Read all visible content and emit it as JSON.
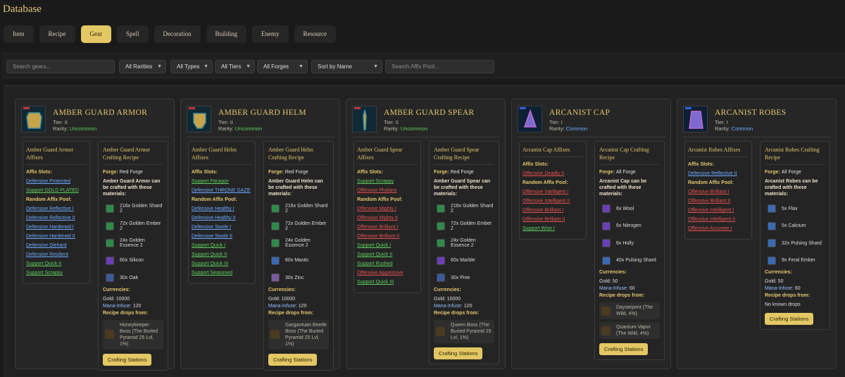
{
  "page": {
    "title": "Database"
  },
  "tabs": [
    {
      "label": "Item",
      "active": false
    },
    {
      "label": "Recipe",
      "active": false
    },
    {
      "label": "Gear",
      "active": true
    },
    {
      "label": "Spell",
      "active": false
    },
    {
      "label": "Decoration",
      "active": false
    },
    {
      "label": "Building",
      "active": false
    },
    {
      "label": "Enemy",
      "active": false
    },
    {
      "label": "Resource",
      "active": false
    }
  ],
  "filters": {
    "search_placeholder": "Search gears...",
    "rarity": "All Rarities",
    "type": "All Types",
    "tier": "All Tiers",
    "forge": "All Forges",
    "sort": "Sort by Name",
    "affix_placeholder": "Search Affix Pool..."
  },
  "labels": {
    "affix_slots": "Affix Slots:",
    "random_pool": "Random Affix Pool:",
    "forge": "Forge:",
    "currencies": "Currencies:",
    "gold": "Gold:",
    "mana": "Mana-Infuse:",
    "recipe_drops": "Recipe drops from:",
    "crafting_stations": "Crafting Stations"
  },
  "gears": [
    {
      "name": "AMBER GUARD ARMOR",
      "tier": "Tier: II",
      "rarity_label": "Rarity:",
      "rarity": "Uncommon",
      "affix_title": "Amber Guard Armor Affixes",
      "slots": [
        {
          "text": "Defensive Protected",
          "kind": "def"
        },
        {
          "text": "Support GOLD PLATED",
          "kind": "sup"
        }
      ],
      "pool": [
        {
          "text": "Defensive Reflective I",
          "kind": "def"
        },
        {
          "text": "Defensive Reflective II",
          "kind": "def"
        },
        {
          "text": "Defensive Hardened I",
          "kind": "def"
        },
        {
          "text": "Defensive Hardened II",
          "kind": "def"
        },
        {
          "text": "Defensive Diehard",
          "kind": "def"
        },
        {
          "text": "Defensive Resilient",
          "kind": "def"
        },
        {
          "text": "Support Quick II",
          "kind": "sup"
        },
        {
          "text": "Support Scrappy",
          "kind": "sup"
        }
      ],
      "recipe_title": "Amber Guard Armor Crafting Recipe",
      "forge": "Red Forge",
      "recipe_desc": "Amber Guard Armor can be crafted with these materials:",
      "materials": [
        {
          "text": "216x Golden Shard 2",
          "icon": "golden-shard-icon",
          "color": "#2f8a4a"
        },
        {
          "text": "72x Golden Ember 2",
          "icon": "golden-ember-icon",
          "color": "#2f8a4a"
        },
        {
          "text": "24x Golden Essence 2",
          "icon": "golden-essence-icon",
          "color": "#2f8a4a"
        },
        {
          "text": "60x Silicon",
          "icon": "silicon-icon",
          "color": "#6a3fb5"
        },
        {
          "text": "30x Oak",
          "icon": "oak-icon",
          "color": "#3a5a9a"
        }
      ],
      "gold": "10000",
      "mana": "120",
      "drops": [
        "Honeykeeper Boss (The Buried Pyramid 25 Lvl, 1%)"
      ]
    },
    {
      "name": "AMBER GUARD HELM",
      "tier": "Tier: II",
      "rarity_label": "Rarity:",
      "rarity": "Uncommon",
      "affix_title": "Amber Guard Helm Affixes",
      "slots": [
        {
          "text": "Support Paragon",
          "kind": "sup"
        },
        {
          "text": "Defensive THRONE GAZE",
          "kind": "def"
        }
      ],
      "pool": [
        {
          "text": "Defensive Healthy I",
          "kind": "def"
        },
        {
          "text": "Defensive Healthy II",
          "kind": "def"
        },
        {
          "text": "Defensive Swole I",
          "kind": "def"
        },
        {
          "text": "Defensive Swole II",
          "kind": "def"
        },
        {
          "text": "Support Quick I",
          "kind": "sup"
        },
        {
          "text": "Support Quick II",
          "kind": "sup"
        },
        {
          "text": "Support Quick III",
          "kind": "sup"
        },
        {
          "text": "Support Seasoned",
          "kind": "sup"
        }
      ],
      "recipe_title": "Amber Guard Helm Crafting Recipe",
      "forge": "Red Forge",
      "recipe_desc": "Amber Guard Helm can be crafted with these materials:",
      "materials": [
        {
          "text": "216x Golden Shard 2",
          "icon": "golden-shard-icon",
          "color": "#2f8a4a"
        },
        {
          "text": "72x Golden Ember 2",
          "icon": "golden-ember-icon",
          "color": "#2f8a4a"
        },
        {
          "text": "24x Golden Essence 2",
          "icon": "golden-essence-icon",
          "color": "#2f8a4a"
        },
        {
          "text": "60x Mastic",
          "icon": "mastic-icon",
          "color": "#3a6ab0"
        },
        {
          "text": "30x Zinc",
          "icon": "zinc-icon",
          "color": "#7a5aa0"
        }
      ],
      "gold": "10000",
      "mana": "120",
      "drops": [
        "Gargantuan Beetle Boss (The Buried Pyramid 25 Lvl, 1%)"
      ]
    },
    {
      "name": "AMBER GUARD SPEAR",
      "tier": "Tier: II",
      "rarity_label": "Rarity:",
      "rarity": "Uncommon",
      "affix_title": "Amber Guard Spear Affixes",
      "slots": [
        {
          "text": "Support Scrappy",
          "kind": "sup"
        },
        {
          "text": "Offensive Phalanx",
          "kind": "off"
        }
      ],
      "pool": [
        {
          "text": "Offensive Mighty I",
          "kind": "off"
        },
        {
          "text": "Offensive Mighty II",
          "kind": "off"
        },
        {
          "text": "Offensive Brilliant I",
          "kind": "off"
        },
        {
          "text": "Offensive Brilliant II",
          "kind": "off"
        },
        {
          "text": "Support Quick I",
          "kind": "sup"
        },
        {
          "text": "Support Quick II",
          "kind": "sup"
        },
        {
          "text": "Support Rushed",
          "kind": "sup"
        },
        {
          "text": "Offensive Aggressive",
          "kind": "off"
        },
        {
          "text": "Support Quick III",
          "kind": "sup"
        }
      ],
      "recipe_title": "Amber Guard Spear Crafting Recipe",
      "forge": "Red Forge",
      "recipe_desc": "Amber Guard Spear can be crafted with these materials:",
      "materials": [
        {
          "text": "216x Golden Shard 2",
          "icon": "golden-shard-icon",
          "color": "#2f8a4a"
        },
        {
          "text": "72x Golden Ember 2",
          "icon": "golden-ember-icon",
          "color": "#2f8a4a"
        },
        {
          "text": "24x Golden Essence 2",
          "icon": "golden-essence-icon",
          "color": "#2f8a4a"
        },
        {
          "text": "60x Marble",
          "icon": "marble-icon",
          "color": "#6a3fb5"
        },
        {
          "text": "30x Pine",
          "icon": "pine-icon",
          "color": "#3a5a9a"
        }
      ],
      "gold": "10000",
      "mana": "120",
      "drops": [
        "Queen Boss (The Buried Pyramid 25 Lvl, 1%)"
      ]
    },
    {
      "name": "ARCANIST CAP",
      "tier": "Tier: I",
      "rarity_label": "Rarity:",
      "rarity": "Common",
      "affix_title": "Arcanist Cap Affixes",
      "slots": [
        {
          "text": "Offensive Deadly II",
          "kind": "off"
        }
      ],
      "pool": [
        {
          "text": "Offensive Intelligent I",
          "kind": "off"
        },
        {
          "text": "Offensive Intelligent II",
          "kind": "off"
        },
        {
          "text": "Offensive Brilliant I",
          "kind": "off"
        },
        {
          "text": "Offensive Brilliant II",
          "kind": "off"
        },
        {
          "text": "Support Wise I",
          "kind": "sup"
        }
      ],
      "recipe_title": "Arcanist Cap Crafting Recipe",
      "forge": "All Forge",
      "recipe_desc": "Arcanist Cap can be crafted with these materials:",
      "materials": [
        {
          "text": "6x Wool",
          "icon": "wool-icon",
          "color": "#6a3fb5"
        },
        {
          "text": "6x Nitrogen",
          "icon": "nitrogen-icon",
          "color": "#6a3fb5"
        },
        {
          "text": "6x Holly",
          "icon": "holly-icon",
          "color": "#6a3fb5"
        },
        {
          "text": "40x Pulsing Shard",
          "icon": "pulsing-shard-icon",
          "color": "#3a6ab0"
        }
      ],
      "gold": "50",
      "mana": "60",
      "drops": [
        "Dayserpent (The Wild, 4%)",
        "Quantum Vapor (The Wild, 4%)"
      ]
    },
    {
      "name": "ARCANIST ROBES",
      "tier": "Tier: I",
      "rarity_label": "Rarity:",
      "rarity": "Common",
      "affix_title": "Arcanist Robes Affixes",
      "slots": [
        {
          "text": "Defensive Reflective II",
          "kind": "def"
        }
      ],
      "pool": [
        {
          "text": "Offensive Brilliant I",
          "kind": "off"
        },
        {
          "text": "Offensive Brilliant II",
          "kind": "off"
        },
        {
          "text": "Offensive Intelligent I",
          "kind": "off"
        },
        {
          "text": "Offensive Intelligent II",
          "kind": "off"
        },
        {
          "text": "Offensive Accurate I",
          "kind": "off"
        }
      ],
      "recipe_title": "Arcanist Robes Crafting Recipe",
      "forge": "All Forge",
      "recipe_desc": "Arcanist Robes can be crafted with these materials:",
      "materials": [
        {
          "text": "5x Flax",
          "icon": "flax-icon",
          "color": "#3a6ab0"
        },
        {
          "text": "5x Calcium",
          "icon": "calcium-icon",
          "color": "#3a6ab0"
        },
        {
          "text": "32x Pulsing Shard",
          "icon": "pulsing-shard-icon",
          "color": "#3a6ab0"
        },
        {
          "text": "9x Feral Ember",
          "icon": "feral-ember-icon",
          "color": "#3a6ab0"
        }
      ],
      "gold": "50",
      "mana": "60",
      "no_drops": "No known drops"
    }
  ]
}
